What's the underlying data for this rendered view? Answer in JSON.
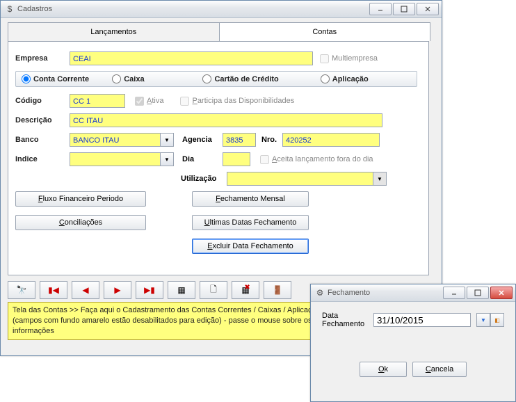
{
  "main_window": {
    "title": "Cadastros",
    "tabs": {
      "lancamentos": "Lançamentos",
      "contas": "Contas"
    },
    "empresa": {
      "label": "Empresa",
      "value": "CEAI",
      "multi_label": "Multiempresa"
    },
    "tipo": {
      "corrente": "Conta Corrente",
      "caixa": "Caixa",
      "cartao": "Cartão de Crédito",
      "aplicacao": "Aplicação"
    },
    "codigo": {
      "label": "Código",
      "value": "CC 1",
      "ativa": "Ativa",
      "participa": "Participa das Disponibilidades"
    },
    "descricao": {
      "label": "Descrição",
      "value": "CC  ITAU"
    },
    "banco": {
      "label": "Banco",
      "value": "BANCO ITAU"
    },
    "agencia": {
      "label": "Agencia",
      "value": "3835"
    },
    "nro": {
      "label": "Nro.",
      "value": "420252"
    },
    "indice": {
      "label": "Indice",
      "value": ""
    },
    "dia": {
      "label": "Dia",
      "value": "",
      "aceita": "Aceita lançamento fora do dia"
    },
    "utilizacao": {
      "label": "Utilização",
      "value": ""
    },
    "buttons": {
      "fluxo": "Fluxo Financeiro Periodo",
      "fechamento_mensal": "Fechamento Mensal",
      "conciliacoes": "Conciliações",
      "ultimas": "Ultimas Datas Fechamento",
      "excluir": "Excluir Data Fechamento"
    },
    "hint": "Tela das Contas >> Faça aqui o Cadastramento das Contas Correntes / Caixas / Aplicações e Cartões de Crédito - (campos com fundo amarelo estão desabilitados para edição) - passe o mouse sobre os campos para obter mais informações"
  },
  "dialog": {
    "title": "Fechamento",
    "label": "Data Fechamento",
    "value": "31/10/2015",
    "ok": "Ok",
    "cancela": "Cancela"
  }
}
